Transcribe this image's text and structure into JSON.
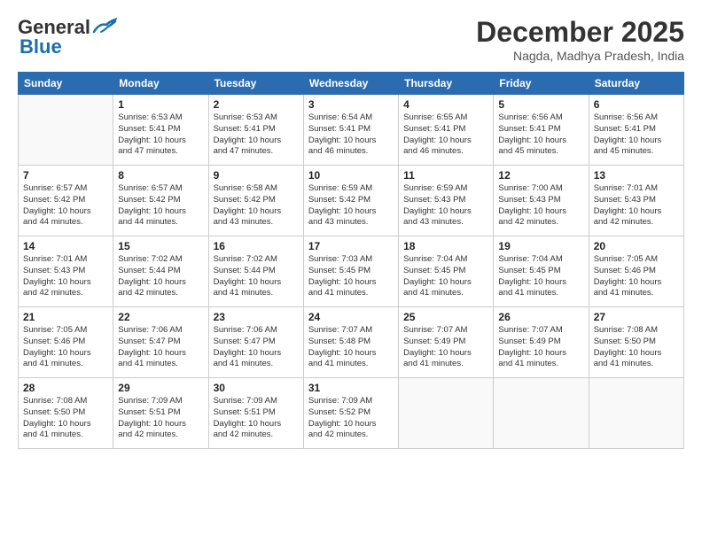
{
  "header": {
    "logo_general": "General",
    "logo_blue": "Blue",
    "month": "December 2025",
    "location": "Nagda, Madhya Pradesh, India"
  },
  "weekdays": [
    "Sunday",
    "Monday",
    "Tuesday",
    "Wednesday",
    "Thursday",
    "Friday",
    "Saturday"
  ],
  "weeks": [
    [
      {
        "day": "",
        "info": ""
      },
      {
        "day": "1",
        "info": "Sunrise: 6:53 AM\nSunset: 5:41 PM\nDaylight: 10 hours\nand 47 minutes."
      },
      {
        "day": "2",
        "info": "Sunrise: 6:53 AM\nSunset: 5:41 PM\nDaylight: 10 hours\nand 47 minutes."
      },
      {
        "day": "3",
        "info": "Sunrise: 6:54 AM\nSunset: 5:41 PM\nDaylight: 10 hours\nand 46 minutes."
      },
      {
        "day": "4",
        "info": "Sunrise: 6:55 AM\nSunset: 5:41 PM\nDaylight: 10 hours\nand 46 minutes."
      },
      {
        "day": "5",
        "info": "Sunrise: 6:56 AM\nSunset: 5:41 PM\nDaylight: 10 hours\nand 45 minutes."
      },
      {
        "day": "6",
        "info": "Sunrise: 6:56 AM\nSunset: 5:41 PM\nDaylight: 10 hours\nand 45 minutes."
      }
    ],
    [
      {
        "day": "7",
        "info": "Sunrise: 6:57 AM\nSunset: 5:42 PM\nDaylight: 10 hours\nand 44 minutes."
      },
      {
        "day": "8",
        "info": "Sunrise: 6:57 AM\nSunset: 5:42 PM\nDaylight: 10 hours\nand 44 minutes."
      },
      {
        "day": "9",
        "info": "Sunrise: 6:58 AM\nSunset: 5:42 PM\nDaylight: 10 hours\nand 43 minutes."
      },
      {
        "day": "10",
        "info": "Sunrise: 6:59 AM\nSunset: 5:42 PM\nDaylight: 10 hours\nand 43 minutes."
      },
      {
        "day": "11",
        "info": "Sunrise: 6:59 AM\nSunset: 5:43 PM\nDaylight: 10 hours\nand 43 minutes."
      },
      {
        "day": "12",
        "info": "Sunrise: 7:00 AM\nSunset: 5:43 PM\nDaylight: 10 hours\nand 42 minutes."
      },
      {
        "day": "13",
        "info": "Sunrise: 7:01 AM\nSunset: 5:43 PM\nDaylight: 10 hours\nand 42 minutes."
      }
    ],
    [
      {
        "day": "14",
        "info": "Sunrise: 7:01 AM\nSunset: 5:43 PM\nDaylight: 10 hours\nand 42 minutes."
      },
      {
        "day": "15",
        "info": "Sunrise: 7:02 AM\nSunset: 5:44 PM\nDaylight: 10 hours\nand 42 minutes."
      },
      {
        "day": "16",
        "info": "Sunrise: 7:02 AM\nSunset: 5:44 PM\nDaylight: 10 hours\nand 41 minutes."
      },
      {
        "day": "17",
        "info": "Sunrise: 7:03 AM\nSunset: 5:45 PM\nDaylight: 10 hours\nand 41 minutes."
      },
      {
        "day": "18",
        "info": "Sunrise: 7:04 AM\nSunset: 5:45 PM\nDaylight: 10 hours\nand 41 minutes."
      },
      {
        "day": "19",
        "info": "Sunrise: 7:04 AM\nSunset: 5:45 PM\nDaylight: 10 hours\nand 41 minutes."
      },
      {
        "day": "20",
        "info": "Sunrise: 7:05 AM\nSunset: 5:46 PM\nDaylight: 10 hours\nand 41 minutes."
      }
    ],
    [
      {
        "day": "21",
        "info": "Sunrise: 7:05 AM\nSunset: 5:46 PM\nDaylight: 10 hours\nand 41 minutes."
      },
      {
        "day": "22",
        "info": "Sunrise: 7:06 AM\nSunset: 5:47 PM\nDaylight: 10 hours\nand 41 minutes."
      },
      {
        "day": "23",
        "info": "Sunrise: 7:06 AM\nSunset: 5:47 PM\nDaylight: 10 hours\nand 41 minutes."
      },
      {
        "day": "24",
        "info": "Sunrise: 7:07 AM\nSunset: 5:48 PM\nDaylight: 10 hours\nand 41 minutes."
      },
      {
        "day": "25",
        "info": "Sunrise: 7:07 AM\nSunset: 5:49 PM\nDaylight: 10 hours\nand 41 minutes."
      },
      {
        "day": "26",
        "info": "Sunrise: 7:07 AM\nSunset: 5:49 PM\nDaylight: 10 hours\nand 41 minutes."
      },
      {
        "day": "27",
        "info": "Sunrise: 7:08 AM\nSunset: 5:50 PM\nDaylight: 10 hours\nand 41 minutes."
      }
    ],
    [
      {
        "day": "28",
        "info": "Sunrise: 7:08 AM\nSunset: 5:50 PM\nDaylight: 10 hours\nand 41 minutes."
      },
      {
        "day": "29",
        "info": "Sunrise: 7:09 AM\nSunset: 5:51 PM\nDaylight: 10 hours\nand 42 minutes."
      },
      {
        "day": "30",
        "info": "Sunrise: 7:09 AM\nSunset: 5:51 PM\nDaylight: 10 hours\nand 42 minutes."
      },
      {
        "day": "31",
        "info": "Sunrise: 7:09 AM\nSunset: 5:52 PM\nDaylight: 10 hours\nand 42 minutes."
      },
      {
        "day": "",
        "info": ""
      },
      {
        "day": "",
        "info": ""
      },
      {
        "day": "",
        "info": ""
      }
    ]
  ]
}
